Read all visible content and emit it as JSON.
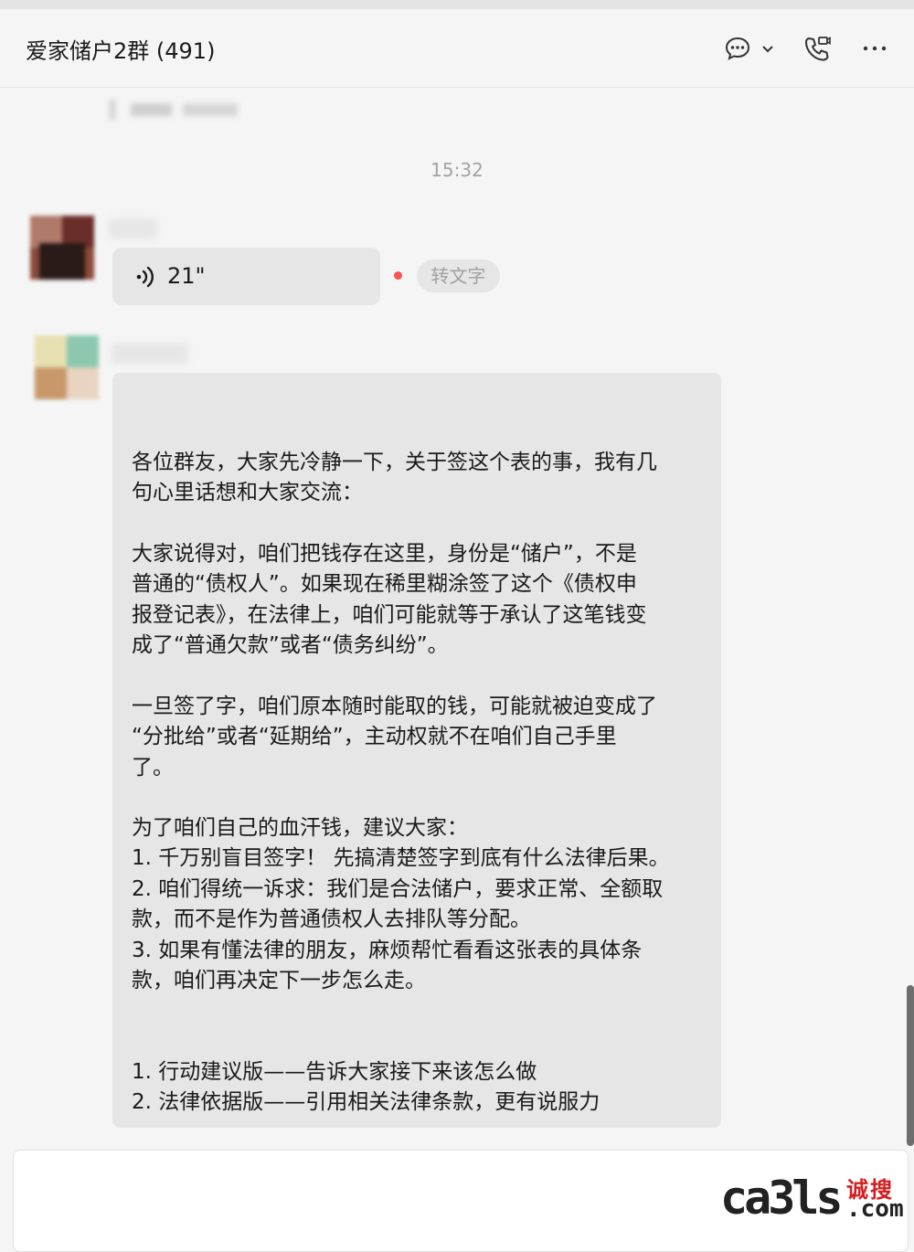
{
  "header": {
    "title": "爱家储户2群 (491)",
    "icons": [
      "chat-bubble-icon",
      "chevron-down-icon",
      "phone-video-icon",
      "more-icon"
    ]
  },
  "messages": {
    "timestamp": "15:32",
    "voice": {
      "duration": "21\"",
      "to_text_label": "转文字"
    },
    "text_message": {
      "paragraphs": [
        "各位群友，大家先冷静一下，关于签这个表的事，我有几\n句心里话想和大家交流：",
        "大家说得对，咱们把钱存在这里，身份是“储户”，不是\n普通的“债权人”。如果现在稀里糊涂签了这个《债权申\n报登记表》，在法律上，咱们可能就等于承认了这笔钱变\n成了“普通欠款”或者“债务纠纷”。",
        "一旦签了字，咱们原本随时能取的钱，可能就被迫变成了\n“分批给”或者“延期给”，主动权就不在咱们自己手里\n了。",
        "为了咱们自己的血汗钱，建议大家：\n1. 千万别盲目签字！ 先搞清楚签字到底有什么法律后果。\n2. 咱们得统一诉求：我们是合法储户，要求正常、全额取\n款，而不是作为普通债权人去排队等分配。\n3. 如果有懂法律的朋友，麻烦帮忙看看这张表的具体条\n款，咱们再决定下一步怎么走。",
        "1. 行动建议版——告诉大家接下来该怎么做\n2. 法律依据版——引用相关法律条款，更有说服力"
      ]
    }
  },
  "watermark": {
    "text": "ca3ls",
    "cn": "诚搜",
    "domain": ".com"
  },
  "colors": {
    "unread_dot": "#fa5151",
    "bubble": "#e6e6e6",
    "background": "#f5f5f5"
  }
}
